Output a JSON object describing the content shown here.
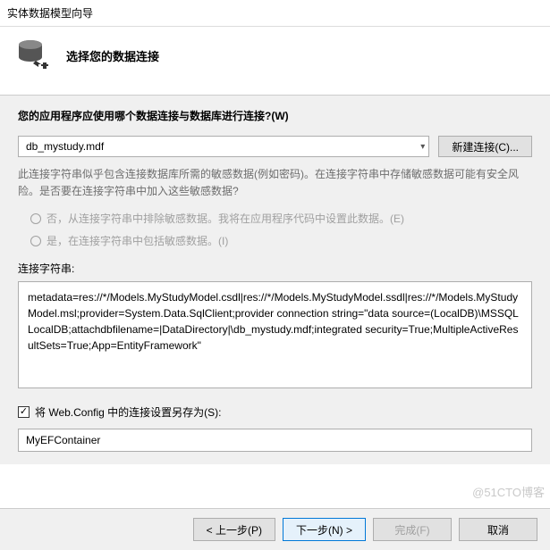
{
  "titlebar": "实体数据模型向导",
  "header": {
    "title": "选择您的数据连接"
  },
  "question": "您的应用程序应使用哪个数据连接与数据库进行连接?(W)",
  "combo_value": "db_mystudy.mdf",
  "new_conn_btn": "新建连接(C)...",
  "desc": "此连接字符串似乎包含连接数据库所需的敏感数据(例如密码)。在连接字符串中存储敏感数据可能有安全风险。是否要在连接字符串中加入这些敏感数据?",
  "radios": {
    "no": "否，从连接字符串中排除敏感数据。我将在应用程序代码中设置此数据。(E)",
    "yes": "是，在连接字符串中包括敏感数据。(I)"
  },
  "connstr_label": "连接字符串:",
  "connstr_value": "metadata=res://*/Models.MyStudyModel.csdl|res://*/Models.MyStudyModel.ssdl|res://*/Models.MyStudyModel.msl;provider=System.Data.SqlClient;provider connection string=\"data source=(LocalDB)\\MSSQLLocalDB;attachdbfilename=|DataDirectory|\\db_mystudy.mdf;integrated security=True;MultipleActiveResultSets=True;App=EntityFramework\"",
  "save_checkbox_label": "将 Web.Config 中的连接设置另存为(S):",
  "save_checkbox_checked": true,
  "container_name": "MyEFContainer",
  "footer": {
    "prev": "< 上一步(P)",
    "next": "下一步(N) >",
    "finish": "完成(F)",
    "cancel": "取消"
  },
  "watermark": "@51CTO博客"
}
